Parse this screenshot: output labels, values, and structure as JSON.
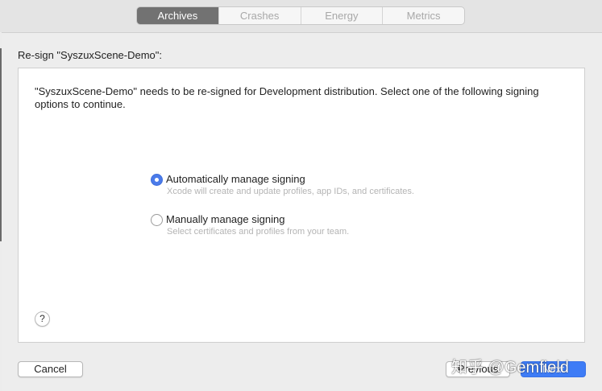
{
  "toolbar": {
    "tabs": [
      {
        "label": "Archives",
        "active": true
      },
      {
        "label": "Crashes",
        "active": false
      },
      {
        "label": "Energy",
        "active": false
      },
      {
        "label": "Metrics",
        "active": false
      }
    ]
  },
  "sheet": {
    "heading": "Re-sign \"SyszuxScene-Demo\":",
    "description": "\"SyszuxScene-Demo\" needs to be re-signed for Development distribution. Select one of the following signing options to continue.",
    "options": [
      {
        "label": "Automatically manage signing",
        "sublabel": "Xcode will create and update profiles, app IDs, and certificates.",
        "selected": true
      },
      {
        "label": "Manually manage signing",
        "sublabel": "Select certificates and profiles from your team.",
        "selected": false
      }
    ],
    "help_label": "?"
  },
  "buttons": {
    "cancel": "Cancel",
    "previous": "Previous",
    "next": "Next"
  },
  "watermark": "知乎 @Gemfield",
  "colors": {
    "accent": "#3e7cf6",
    "active_tab": "#727272"
  }
}
